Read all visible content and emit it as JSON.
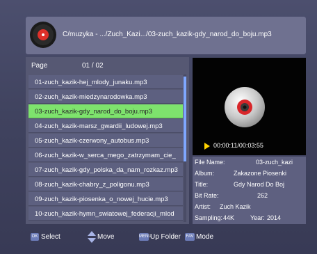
{
  "header": {
    "path": "C/muzyka - .../Zuch_Kazi.../03-zuch_kazik-gdy_narod_do_boju.mp3",
    "icon": "music-disc-icon"
  },
  "list": {
    "page_label": "Page",
    "page_value": "01 / 02",
    "items": [
      "01-zuch_kazik-hej_mlody_junaku.mp3",
      "02-zuch_kazik-miedzynarodowka.mp3",
      "03-zuch_kazik-gdy_narod_do_boju.mp3",
      "04-zuch_kazik-marsz_gwardii_ludowej.mp3",
      "05-zuch_kazik-czerwony_autobus.mp3",
      "06-zuch_kazik-w_serca_mego_zatrzymam_cie_",
      "07-zuch_kazik-gdy_polska_da_nam_rozkaz.mp3",
      "08-zuch_kazik-chabry_z_poligonu.mp3",
      "09-zuch_kazik-piosenka_o_nowej_hucie.mp3",
      "10-zuch_kazik-hymn_swiatowej_federacji_mlod"
    ],
    "selected_index": 2
  },
  "preview": {
    "time": "00:00:11/00:03:55",
    "play_icon": "play-icon",
    "disc_icon": "cd-icon"
  },
  "info": {
    "file_name_label": "File Name:",
    "file_name_value": "03-zuch_kazi",
    "album_label": "Album:",
    "album_value": "Zakazone Piosenki",
    "title_label": "Title:",
    "title_value": "Gdy Narod Do Boj",
    "bitrate_label": "Bit Rate:",
    "bitrate_value": "262",
    "artist_label": "Artist:",
    "artist_value": "Zuch Kazik",
    "sampling_label": "Sampling:",
    "sampling_value": "44K",
    "year_label": "Year:",
    "year_value": "2014"
  },
  "footer": {
    "ok_key": "OK",
    "ok_label": "Select",
    "move_label": "Move",
    "menu_key": "MENU",
    "menu_label": "Up Folder",
    "fav_key": "FAV",
    "fav_label": "Mode"
  }
}
